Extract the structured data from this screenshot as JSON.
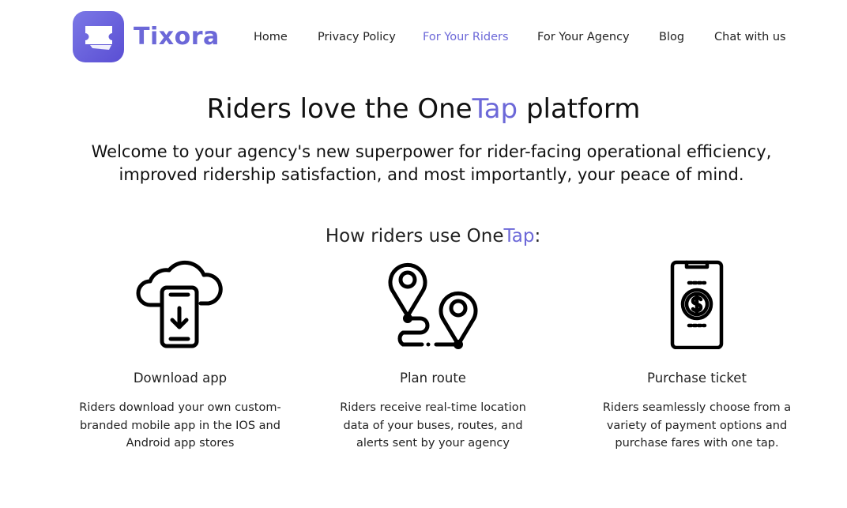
{
  "brand": {
    "name": "Tixora",
    "icon": "ticket-logo-icon",
    "colors": {
      "accent": "#6c68d8",
      "logo_gradient_start": "#7b78e6",
      "logo_gradient_end": "#5a4ed3"
    }
  },
  "nav": {
    "items": [
      {
        "label": "Home",
        "active": false
      },
      {
        "label": "Privacy Policy",
        "active": false
      },
      {
        "label": "For Your Riders",
        "active": true
      },
      {
        "label": "For Your Agency",
        "active": false
      },
      {
        "label": "Blog",
        "active": false
      },
      {
        "label": "Chat with us",
        "active": false
      }
    ]
  },
  "hero": {
    "title_pre": "Riders love the One",
    "title_accent": "Tap",
    "title_post": " platform",
    "subtitle": "Welcome to your agency's new superpower for rider-facing operational efficiency, improved ridership satisfaction, and most importantly, your peace of mind."
  },
  "how": {
    "title_pre": "How riders use One",
    "title_accent": "Tap",
    "title_post": ":"
  },
  "features": [
    {
      "icon": "cloud-download-phone-icon",
      "title": "Download app",
      "description": "Riders download your own custom-branded mobile app in the IOS and Android app stores"
    },
    {
      "icon": "route-pins-icon",
      "title": "Plan route",
      "description": "Riders receive real-time location data of your buses, routes, and alerts sent by your agency"
    },
    {
      "icon": "phone-payment-icon",
      "title": "Purchase ticket",
      "description": "Riders seamlessly choose from a variety of payment options and purchase fares with one tap."
    }
  ]
}
